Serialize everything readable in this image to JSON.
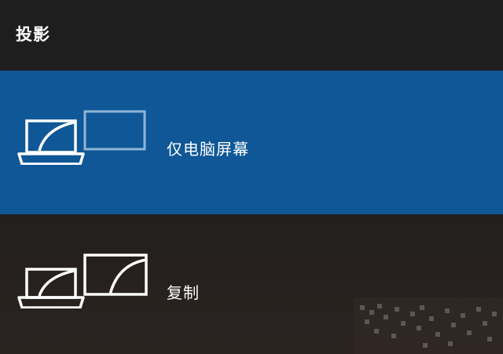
{
  "panel": {
    "title": "投影",
    "accent_color": "#0f5796"
  },
  "options": [
    {
      "label": "仅电脑屏幕",
      "icon": "pc-screen-only-icon",
      "selected": true
    },
    {
      "label": "复制",
      "icon": "duplicate-screen-icon",
      "selected": false
    }
  ]
}
